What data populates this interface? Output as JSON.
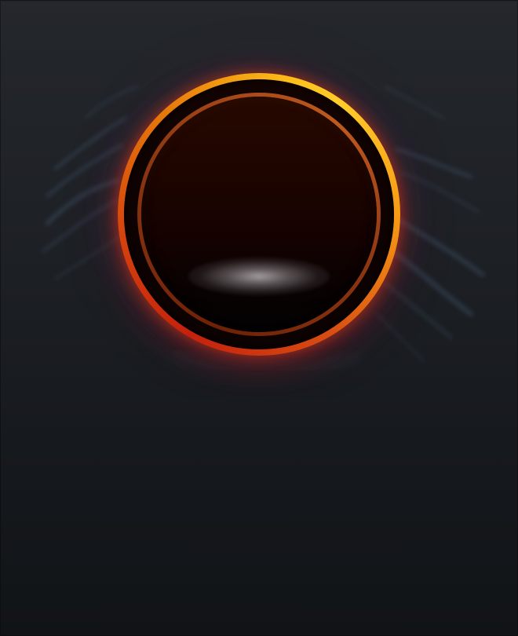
{
  "screen": {
    "background_top": "#24272c",
    "background_bottom": "#111417"
  },
  "power_button": {
    "icon": "power-orb-icon",
    "rim_colors": [
      "#c5200c",
      "#e77b0b",
      "#ffcd2a"
    ],
    "face_color": "#1d0500",
    "glow_color": "#c81414"
  },
  "decoration": {
    "wisp_color": "#5a7896"
  }
}
